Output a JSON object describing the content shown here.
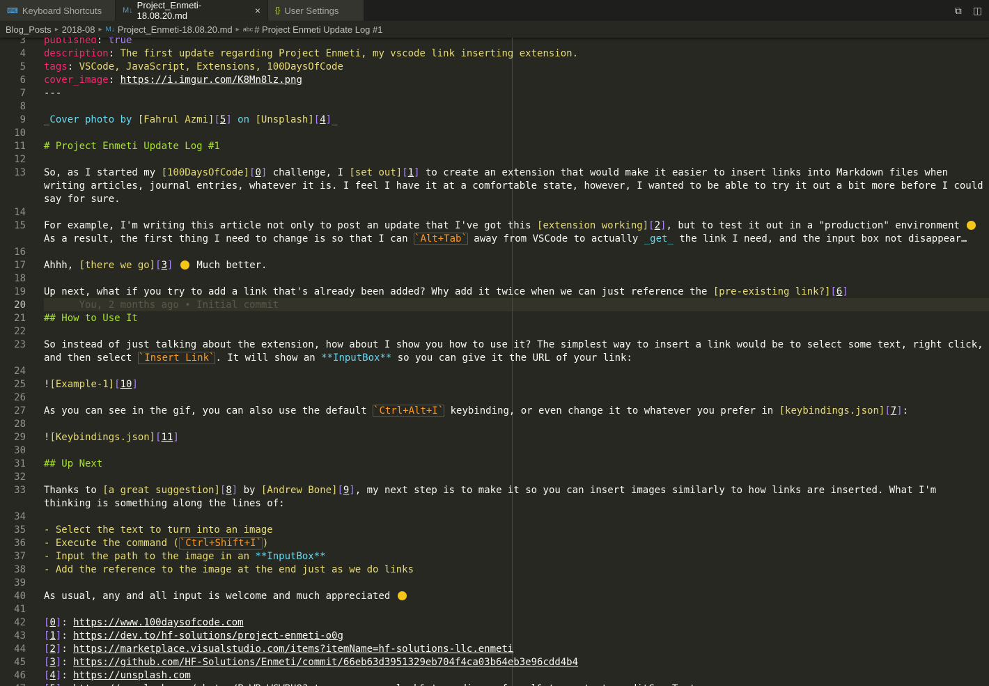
{
  "tabs": [
    {
      "label": "Keyboard Shortcuts",
      "icon": "keyboard-icon",
      "active": false
    },
    {
      "label": "Project_Enmeti-18.08.20.md",
      "icon": "markdown-icon",
      "active": true
    },
    {
      "label": "User Settings",
      "icon": "json-icon",
      "active": false
    }
  ],
  "breadcrumbs": [
    "Blog_Posts",
    "2018-08",
    "Project_Enmeti-18.08.20.md",
    "# Project Enmeti Update Log #1"
  ],
  "lines": [
    {
      "n": "3",
      "parts": [
        [
          "k",
          "published"
        ],
        [
          "c",
          ": "
        ],
        [
          "b",
          "true"
        ]
      ]
    },
    {
      "n": "4",
      "parts": [
        [
          "k",
          "description"
        ],
        [
          "c",
          ": "
        ],
        [
          "s",
          "The first update regarding Project Enmeti, my vscode link inserting extension."
        ]
      ]
    },
    {
      "n": "5",
      "parts": [
        [
          "k",
          "tags"
        ],
        [
          "c",
          ": "
        ],
        [
          "s",
          "VSCode, JavaScript, Extensions, 100DaysOfCode"
        ]
      ]
    },
    {
      "n": "6",
      "parts": [
        [
          "k",
          "cover_image"
        ],
        [
          "c",
          ": "
        ],
        [
          "u",
          "https://i.imgur.com/K8Mn8lz.png"
        ]
      ]
    },
    {
      "n": "7",
      "parts": [
        [
          "c",
          "---"
        ]
      ]
    },
    {
      "n": "8",
      "parts": []
    },
    {
      "n": "9",
      "parts": [
        [
          "i",
          "_Cover photo by "
        ],
        [
          "s",
          "[Fahrul Azmi]"
        ],
        [
          "b",
          "["
        ],
        [
          "u",
          "5"
        ],
        [
          "b",
          "]"
        ],
        [
          "i",
          " on "
        ],
        [
          "s",
          "[Unsplash]"
        ],
        [
          "b",
          "["
        ],
        [
          "u",
          "4"
        ],
        [
          "b",
          "]"
        ],
        [
          "i",
          "_"
        ]
      ]
    },
    {
      "n": "10",
      "parts": []
    },
    {
      "n": "11",
      "parts": [
        [
          "h",
          "# Project Enmeti Update Log #1"
        ]
      ]
    },
    {
      "n": "12",
      "parts": []
    },
    {
      "n": "13",
      "parts": [
        [
          "c",
          "So, as I started my "
        ],
        [
          "s",
          "[100DaysOfCode]"
        ],
        [
          "b",
          "["
        ],
        [
          "u",
          "0"
        ],
        [
          "b",
          "]"
        ],
        [
          "c",
          " challenge, I "
        ],
        [
          "s",
          "[set out]"
        ],
        [
          "b",
          "["
        ],
        [
          "u",
          "1"
        ],
        [
          "b",
          "]"
        ],
        [
          "c",
          " to create an extension that would make it easier to insert links into Markdown files when"
        ]
      ]
    },
    {
      "n": "",
      "parts": [
        [
          "c",
          "writing articles, journal entries, whatever it is. I feel I have it at a comfortable state, however, I wanted to be able to try it out a bit more before I could"
        ]
      ]
    },
    {
      "n": "",
      "parts": [
        [
          "c",
          "say for sure."
        ]
      ]
    },
    {
      "n": "14",
      "parts": []
    },
    {
      "n": "15",
      "parts": [
        [
          "c",
          "For example, I'm writing this article not only to post an update that I've got this "
        ],
        [
          "s",
          "[extension working]"
        ],
        [
          "b",
          "["
        ],
        [
          "u",
          "2"
        ],
        [
          "b",
          "]"
        ],
        [
          "c",
          ", but to test it out in a \"production\" environment "
        ],
        [
          "e",
          ""
        ]
      ]
    },
    {
      "n": "",
      "parts": [
        [
          "c",
          "As a result, the first thing I need to change is so that I can "
        ],
        [
          "x",
          "`Alt+Tab`"
        ],
        [
          "c",
          " away from VSCode to actually "
        ],
        [
          "i",
          "_get_"
        ],
        [
          "c",
          " the link I need, and the input box not disappear…"
        ]
      ]
    },
    {
      "n": "16",
      "parts": []
    },
    {
      "n": "17",
      "parts": [
        [
          "c",
          "Ahhh, "
        ],
        [
          "s",
          "[there we go]"
        ],
        [
          "b",
          "["
        ],
        [
          "u",
          "3"
        ],
        [
          "b",
          "]"
        ],
        [
          "c",
          " "
        ],
        [
          "e",
          ""
        ],
        [
          "c",
          " Much better."
        ]
      ]
    },
    {
      "n": "18",
      "parts": []
    },
    {
      "n": "19",
      "parts": [
        [
          "c",
          "Up next, what if you try to add a link that's already been added? Why add it twice when we can just reference the "
        ],
        [
          "s",
          "[pre-existing link?]"
        ],
        [
          "b",
          "["
        ],
        [
          "u",
          "6"
        ],
        [
          "b",
          "]"
        ]
      ]
    },
    {
      "n": "20",
      "parts": [
        [
          "g",
          "      You, 2 months ago • Initial commit"
        ]
      ]
    },
    {
      "n": "21",
      "parts": [
        [
          "h",
          "## How to Use It"
        ]
      ]
    },
    {
      "n": "22",
      "parts": []
    },
    {
      "n": "23",
      "parts": [
        [
          "c",
          "So instead of just talking about the extension, how about I show you how to use it? The simplest way to insert a link would be to select some text, right click,"
        ]
      ]
    },
    {
      "n": "",
      "parts": [
        [
          "c",
          "and then select "
        ],
        [
          "x",
          "`Insert Link`"
        ],
        [
          "c",
          ". It will show an "
        ],
        [
          "i",
          "**InputBox**"
        ],
        [
          "c",
          " so you can give it the URL of your link:"
        ]
      ]
    },
    {
      "n": "24",
      "parts": []
    },
    {
      "n": "25",
      "parts": [
        [
          "c",
          "!"
        ],
        [
          "s",
          "[Example-1]"
        ],
        [
          "b",
          "["
        ],
        [
          "u",
          "10"
        ],
        [
          "b",
          "]"
        ]
      ]
    },
    {
      "n": "26",
      "parts": []
    },
    {
      "n": "27",
      "parts": [
        [
          "c",
          "As you can see in the gif, you can also use the default "
        ],
        [
          "x",
          "`Ctrl+Alt+I`"
        ],
        [
          "c",
          " keybinding, or even change it to whatever you prefer in "
        ],
        [
          "s",
          "[keybindings.json]"
        ],
        [
          "b",
          "["
        ],
        [
          "u",
          "7"
        ],
        [
          "b",
          "]"
        ],
        [
          "c",
          ":"
        ]
      ]
    },
    {
      "n": "28",
      "parts": []
    },
    {
      "n": "29",
      "parts": [
        [
          "c",
          "!"
        ],
        [
          "s",
          "[Keybindings.json]"
        ],
        [
          "b",
          "["
        ],
        [
          "u",
          "11"
        ],
        [
          "b",
          "]"
        ]
      ]
    },
    {
      "n": "30",
      "parts": []
    },
    {
      "n": "31",
      "parts": [
        [
          "h",
          "## Up Next"
        ]
      ]
    },
    {
      "n": "32",
      "parts": []
    },
    {
      "n": "33",
      "parts": [
        [
          "c",
          "Thanks to "
        ],
        [
          "s",
          "[a great suggestion]"
        ],
        [
          "b",
          "["
        ],
        [
          "u",
          "8"
        ],
        [
          "b",
          "]"
        ],
        [
          "c",
          " by "
        ],
        [
          "s",
          "[Andrew Bone]"
        ],
        [
          "b",
          "["
        ],
        [
          "u",
          "9"
        ],
        [
          "b",
          "]"
        ],
        [
          "c",
          ", my next step is to make it so you can insert images similarly to how links are inserted. What I'm"
        ]
      ]
    },
    {
      "n": "",
      "parts": [
        [
          "c",
          "thinking is something along the lines of:"
        ]
      ]
    },
    {
      "n": "34",
      "parts": []
    },
    {
      "n": "35",
      "parts": [
        [
          "s",
          "- Select the text to turn into an image"
        ]
      ]
    },
    {
      "n": "36",
      "parts": [
        [
          "s",
          "- Execute the command ("
        ],
        [
          "x",
          "`Ctrl+Shift+I`"
        ],
        [
          "s",
          ")"
        ]
      ]
    },
    {
      "n": "37",
      "parts": [
        [
          "s",
          "- Input the path to the image in an "
        ],
        [
          "i",
          "**InputBox**"
        ]
      ]
    },
    {
      "n": "38",
      "parts": [
        [
          "s",
          "- Add the reference to the image at the end just as we do links"
        ]
      ]
    },
    {
      "n": "39",
      "parts": []
    },
    {
      "n": "40",
      "parts": [
        [
          "c",
          "As usual, any and all input is welcome and much appreciated "
        ],
        [
          "e",
          ""
        ]
      ]
    },
    {
      "n": "41",
      "parts": []
    },
    {
      "n": "42",
      "parts": [
        [
          "b",
          "["
        ],
        [
          "u",
          "0"
        ],
        [
          "b",
          "]"
        ],
        [
          "c",
          ": "
        ],
        [
          "u",
          "https://www.100daysofcode.com"
        ]
      ]
    },
    {
      "n": "43",
      "parts": [
        [
          "b",
          "["
        ],
        [
          "u",
          "1"
        ],
        [
          "b",
          "]"
        ],
        [
          "c",
          ": "
        ],
        [
          "u",
          "https://dev.to/hf-solutions/project-enmeti-o0g"
        ]
      ]
    },
    {
      "n": "44",
      "parts": [
        [
          "b",
          "["
        ],
        [
          "u",
          "2"
        ],
        [
          "b",
          "]"
        ],
        [
          "c",
          ": "
        ],
        [
          "u",
          "https://marketplace.visualstudio.com/items?itemName=hf-solutions-llc.enmeti"
        ]
      ]
    },
    {
      "n": "45",
      "parts": [
        [
          "b",
          "["
        ],
        [
          "u",
          "3"
        ],
        [
          "b",
          "]"
        ],
        [
          "c",
          ": "
        ],
        [
          "u",
          "https://github.com/HF-Solutions/Enmeti/commit/66eb63d3951329eb704f4ca03b64eb3e96cdd4b4"
        ]
      ]
    },
    {
      "n": "46",
      "parts": [
        [
          "b",
          "["
        ],
        [
          "u",
          "4"
        ],
        [
          "b",
          "]"
        ],
        [
          "c",
          ": "
        ],
        [
          "u",
          "https://unsplash.com"
        ]
      ]
    },
    {
      "n": "47",
      "parts": [
        [
          "b",
          "["
        ],
        [
          "u",
          "5"
        ],
        [
          "b",
          "]"
        ],
        [
          "c",
          ": "
        ],
        [
          "u",
          "https://unsplash.com/photos/PsWRcWGWBUQ?utm_source=unsplash&utm_medium=referral&utm_content=creditCopyText"
        ]
      ]
    }
  ],
  "current_line": "20"
}
